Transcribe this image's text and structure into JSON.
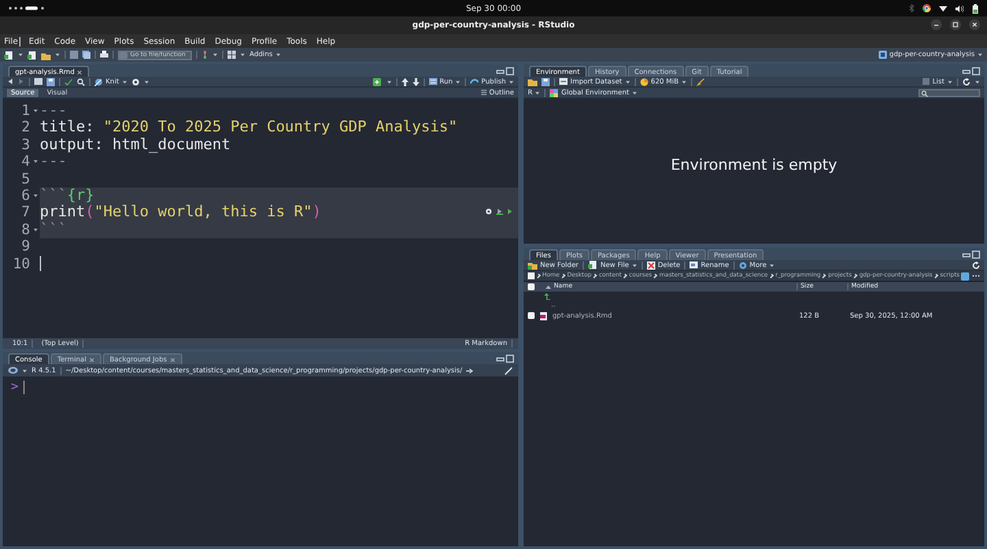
{
  "top_bar": {
    "clock": "Sep 30  00:00"
  },
  "window": {
    "title": "gdp-per-country-analysis - RStudio"
  },
  "menu": [
    {
      "label": "File",
      "selected": true
    },
    {
      "label": "Edit",
      "selected": false
    },
    {
      "label": "Code",
      "selected": false
    },
    {
      "label": "View",
      "selected": false
    },
    {
      "label": "Plots",
      "selected": false
    },
    {
      "label": "Session",
      "selected": false
    },
    {
      "label": "Build",
      "selected": false
    },
    {
      "label": "Debug",
      "selected": false
    },
    {
      "label": "Profile",
      "selected": false
    },
    {
      "label": "Tools",
      "selected": false
    },
    {
      "label": "Help",
      "selected": false
    }
  ],
  "toolbar": {
    "search": {
      "placeholder": "Go to file/function"
    },
    "addins": "Addins",
    "project": "gdp-per-country-analysis"
  },
  "source_pane": {
    "tabs": [
      {
        "label": "gpt-analysis.Rmd",
        "selected": true,
        "closable": true
      }
    ],
    "actions": {
      "knit": "Knit",
      "run": "Run",
      "publish": "Publish"
    },
    "modes": [
      {
        "label": "Source",
        "selected": true
      },
      {
        "label": "Visual",
        "selected": false
      }
    ],
    "outline": "Outline",
    "lines": [
      {
        "number": "1",
        "foldable": true,
        "chunk": false,
        "cursor": false,
        "tokens": [
          {
            "text": "---",
            "kind": "dash"
          }
        ]
      },
      {
        "number": "2",
        "foldable": false,
        "chunk": false,
        "cursor": false,
        "tokens": [
          {
            "text": "title: ",
            "kind": "plain"
          },
          {
            "text": "\"2020 To 2025 Per Country GDP Analysis\"",
            "kind": "string"
          }
        ]
      },
      {
        "number": "3",
        "foldable": false,
        "chunk": false,
        "cursor": false,
        "tokens": [
          {
            "text": "output: html_document",
            "kind": "plain"
          }
        ]
      },
      {
        "number": "4",
        "foldable": true,
        "chunk": false,
        "cursor": false,
        "tokens": [
          {
            "text": "---",
            "kind": "dash"
          }
        ]
      },
      {
        "number": "5",
        "foldable": false,
        "chunk": false,
        "cursor": false
      },
      {
        "number": "6",
        "foldable": true,
        "chunk": true,
        "cursor": false,
        "tokens": [
          {
            "text": "```",
            "kind": "dash"
          },
          {
            "text": "{r}",
            "kind": "chunk"
          }
        ]
      },
      {
        "number": "7",
        "foldable": false,
        "chunk": true,
        "cursor": false,
        "tokens": [
          {
            "text": "print",
            "kind": "plain"
          },
          {
            "text": "(",
            "kind": "paren"
          },
          {
            "text": "\"Hello world, this is R\"",
            "kind": "string"
          },
          {
            "text": ")",
            "kind": "paren"
          }
        ]
      },
      {
        "number": "8",
        "foldable": true,
        "chunk": true,
        "cursor": false,
        "tokens": [
          {
            "text": "```",
            "kind": "dash"
          }
        ]
      },
      {
        "number": "9",
        "foldable": false,
        "chunk": false,
        "cursor": false
      },
      {
        "number": "10",
        "foldable": false,
        "chunk": false,
        "cursor": true
      }
    ],
    "status": {
      "position": "10:1",
      "scope": "(Top Level)",
      "file_type": "R Markdown"
    }
  },
  "console_pane": {
    "tabs": [
      {
        "label": "Console",
        "selected": true,
        "closable": false
      },
      {
        "label": "Terminal",
        "selected": false,
        "closable": true
      },
      {
        "label": "Background Jobs",
        "selected": false,
        "closable": true
      }
    ],
    "version": "R 4.5.1",
    "path": "~/Desktop/content/courses/masters_statistics_and_data_science/r_programming/projects/gdp-per-country-analysis/",
    "prompt": ">"
  },
  "environment_pane": {
    "tabs": [
      {
        "label": "Environment",
        "selected": true
      },
      {
        "label": "History",
        "selected": false
      },
      {
        "label": "Connections",
        "selected": false
      },
      {
        "label": "Git",
        "selected": false
      },
      {
        "label": "Tutorial",
        "selected": false
      }
    ],
    "import": "Import Dataset",
    "memory": "620 MiB",
    "view": "List",
    "language": "R",
    "scope": "Global Environment",
    "message": "Environment is empty"
  },
  "files_pane": {
    "tabs": [
      {
        "label": "Files",
        "selected": true
      },
      {
        "label": "Plots",
        "selected": false
      },
      {
        "label": "Packages",
        "selected": false
      },
      {
        "label": "Help",
        "selected": false
      },
      {
        "label": "Viewer",
        "selected": false
      },
      {
        "label": "Presentation",
        "selected": false
      }
    ],
    "actions": [
      {
        "label": "New Folder",
        "kind": "folder"
      },
      {
        "label": "New File",
        "kind": "file"
      },
      {
        "label": "Delete",
        "kind": "delete"
      },
      {
        "label": "Rename",
        "kind": "rename"
      },
      {
        "label": "More",
        "kind": "more"
      }
    ],
    "breadcrumb": [
      "Home",
      "Desktop",
      "content",
      "courses",
      "masters_statistics_and_data_science",
      "r_programming",
      "projects",
      "gdp-per-country-analysis",
      "scripts"
    ],
    "columns": [
      "Name",
      "Size",
      "Modified"
    ],
    "select_all": false,
    "rows": [
      {
        "kind": "up",
        "name": ".."
      },
      {
        "kind": "file",
        "name": "gpt-analysis.Rmd",
        "size": "122 B",
        "modified": "Sep 30, 2025, 12:00 AM",
        "checked": false
      }
    ]
  }
}
